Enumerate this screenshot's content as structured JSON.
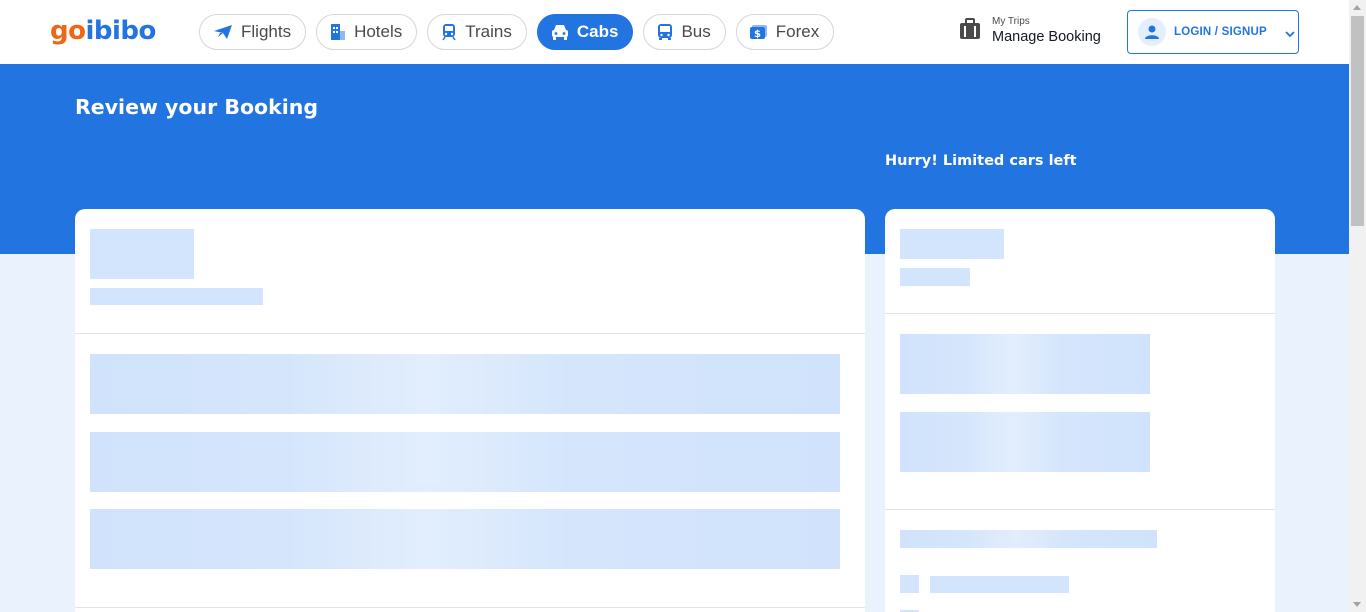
{
  "header": {
    "logo_part1": "go",
    "logo_part2": "ibibo",
    "nav": [
      {
        "label": "Flights",
        "icon": "flight-icon",
        "active": false
      },
      {
        "label": "Hotels",
        "icon": "hotel-icon",
        "active": false
      },
      {
        "label": "Trains",
        "icon": "train-icon",
        "active": false
      },
      {
        "label": "Cabs",
        "icon": "cab-icon",
        "active": true
      },
      {
        "label": "Bus",
        "icon": "bus-icon",
        "active": false
      },
      {
        "label": "Forex",
        "icon": "forex-icon",
        "active": false
      }
    ],
    "trips_small": "My Trips",
    "trips_big": "Manage Booking",
    "login_label": "LOGIN / SIGNUP"
  },
  "hero": {
    "title": "Review your Booking",
    "hurry": "Hurry! Limited cars left"
  },
  "colors": {
    "brand_blue": "#2274e0",
    "brand_orange": "#ef6614",
    "skeleton": "#d3e5fc",
    "page_bg": "#eaf2fe"
  }
}
